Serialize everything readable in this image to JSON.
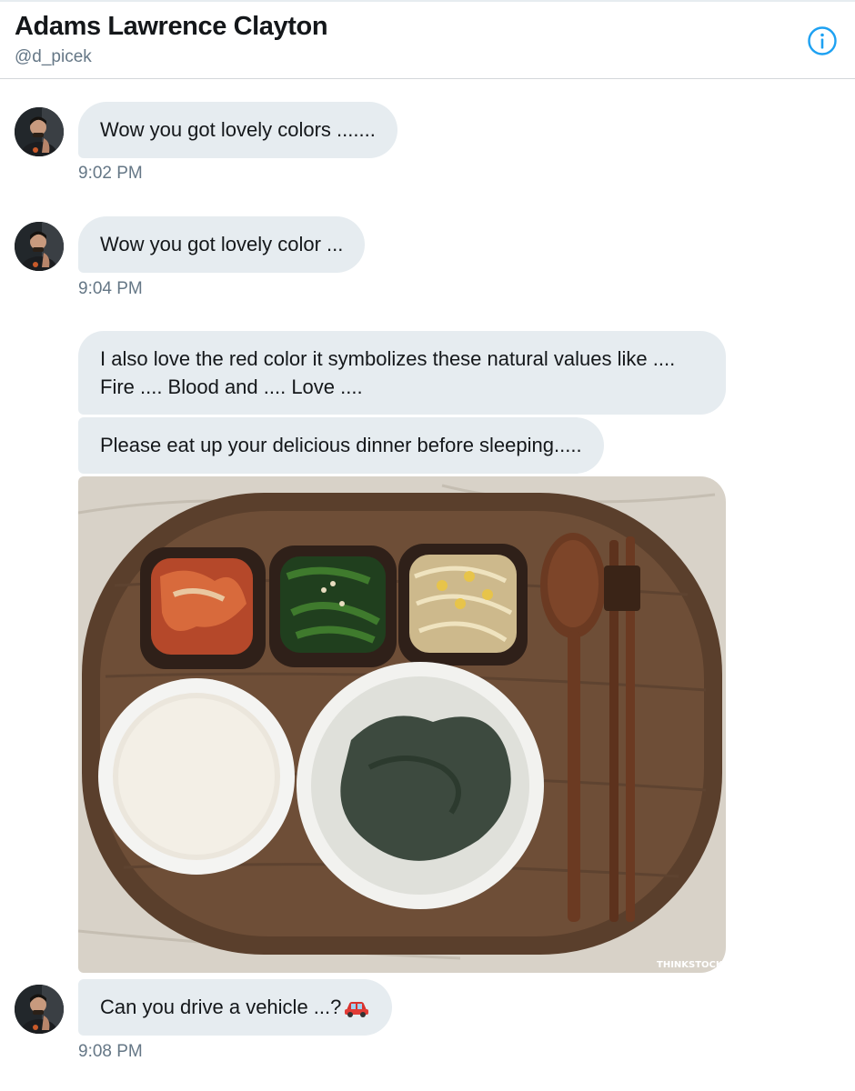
{
  "header": {
    "name": "Adams Lawrence Clayton",
    "handle": "@d_picek"
  },
  "messages": [
    {
      "text": "Wow you got lovely colors .......",
      "time": "9:02 PM"
    },
    {
      "text": "Wow you got lovely color ...",
      "time": "9:04 PM"
    },
    {
      "text": "I also love the red color it symbolizes these natural values like .... Fire .... Blood and .... Love ...."
    },
    {
      "text": "Please eat up your delicious dinner before sleeping....."
    },
    {
      "image": {
        "watermark": "THINKSTOCK",
        "description_icon": "food-tray-photo"
      }
    },
    {
      "text": "Can you drive a vehicle ...?",
      "emoji": "car-icon",
      "time": "9:08 PM"
    }
  ],
  "colors": {
    "bubble": "#e6ecf0",
    "accent": "#1da1f2",
    "muted": "#657786",
    "text": "#14171a"
  }
}
